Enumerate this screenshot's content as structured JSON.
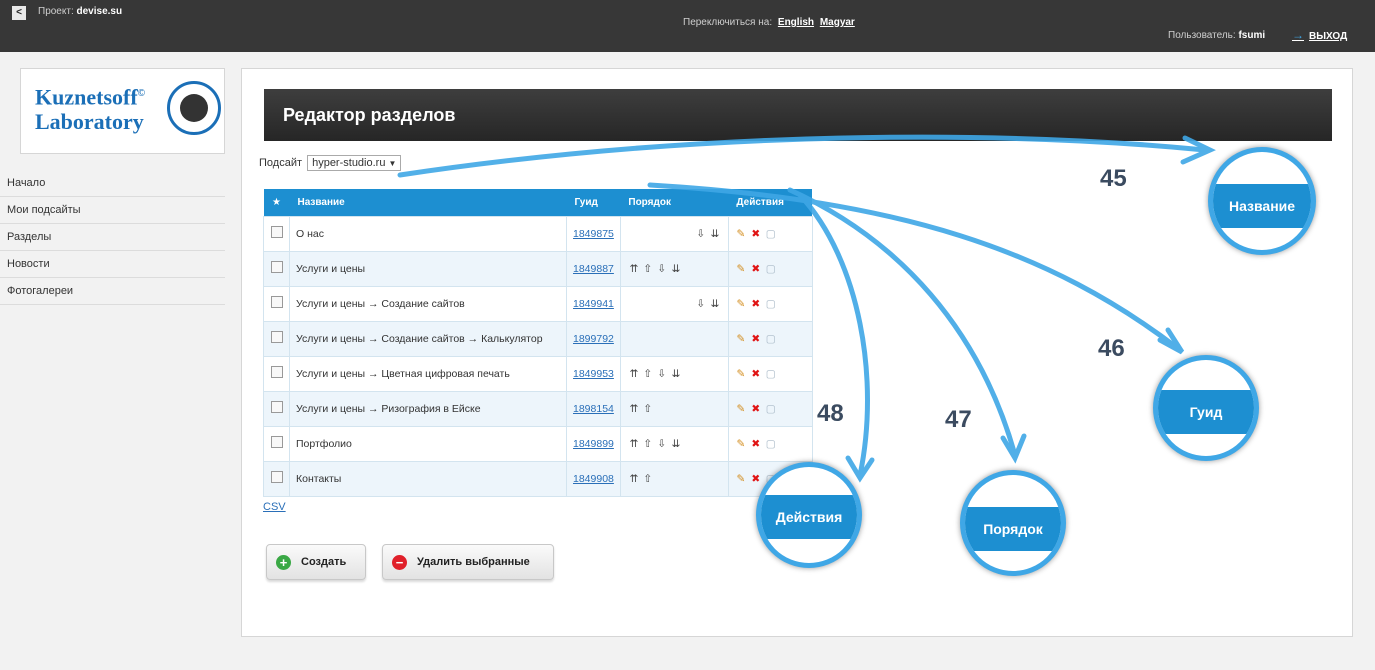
{
  "topbar": {
    "back_label": "<",
    "project_label": "Проект:",
    "project_name": "devise.su",
    "switch_label": "Переключиться на:",
    "lang_en": "English",
    "lang_hu": "Magyar",
    "user_label": "Пользователь:",
    "user_name": "fsumi",
    "logout": "ВЫХОД"
  },
  "logo": {
    "line1": "Kuznetsoff",
    "line2": "Laboratory"
  },
  "nav": [
    "Начало",
    "Мои подсайты",
    "Разделы",
    "Новости",
    "Фотогалереи"
  ],
  "page": {
    "title": "Редактор разделов",
    "subsite_label": "Подсайт",
    "subsite_value": "hyper-studio.ru"
  },
  "table": {
    "headers": {
      "star": "★",
      "name": "Название",
      "guid": "Гуид",
      "order": "Порядок",
      "actions": "Действия"
    },
    "rows": [
      {
        "name": "О нас",
        "guid": "1849875"
      },
      {
        "name": "Услуги и цены",
        "guid": "1849887"
      },
      {
        "name": "Услуги и цены → Создание сайтов",
        "guid": "1849941"
      },
      {
        "name": "Услуги и цены → Создание сайтов → Калькулятор",
        "guid": "1899792"
      },
      {
        "name": "Услуги и цены → Цветная цифровая печать",
        "guid": "1849953"
      },
      {
        "name": "Услуги и цены → Ризография в Ейске",
        "guid": "1898154"
      },
      {
        "name": "Портфолио",
        "guid": "1849899"
      },
      {
        "name": "Контакты",
        "guid": "1849908"
      }
    ]
  },
  "csv_label": "CSV",
  "buttons": {
    "create": "Создать",
    "delete_selected": "Удалить выбранные"
  },
  "callouts": {
    "n45": "45",
    "n46": "46",
    "n47": "47",
    "n48": "48",
    "lens_name": "Название",
    "lens_guid": "Гуид",
    "lens_order": "Порядок",
    "lens_actions": "Действия"
  },
  "colors": {
    "accent": "#1d8fd1",
    "topbar": "#373737",
    "callout": "#3fa7e6"
  }
}
